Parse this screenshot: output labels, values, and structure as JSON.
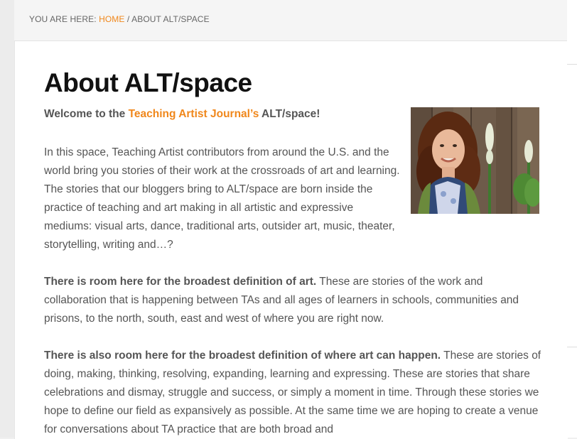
{
  "breadcrumb": {
    "prefix": "YOU ARE HERE: ",
    "home": "HOME",
    "separator": " / ",
    "current": "ABOUT ALT/SPACE"
  },
  "page": {
    "title": "About ALT/space",
    "welcome_prefix": "Welcome to the ",
    "welcome_link": "Teaching Artist Journal’s",
    "welcome_suffix": " ALT/space!",
    "intro": "In this space, Teaching Artist contributors  from around the U.S. and the world bring you stories of their work at the crossroads of art and learning. The stories that our bloggers bring to ALT/space are born inside the practice of teaching and art making in all artistic and expressive mediums: visual arts, dance, traditional arts, outsider art, music, theater, storytelling, writing and…?",
    "p2_bold": "There is room here for the broadest definition of art.",
    "p2_text": " These are stories of the work and collaboration that is happening between TAs and all ages of learners in schools, communities and prisons, to the north, south, east and west of where you are right now.",
    "p3_bold": "There is also room here for the broadest definition of where art can happen.",
    "p3_text": " These are stories of doing, making, thinking, resolving, expanding, learning and expressing.   These are stories that share celebrations and dismay, struggle and success, or simply a moment in time. Through these stories we hope to define our field as expansively as possible.  At the same time we are hoping to create a venue for conversations about TA practice that are both broad and"
  },
  "colors": {
    "accent": "#f0871b",
    "text": "#555555",
    "title": "#111111"
  }
}
